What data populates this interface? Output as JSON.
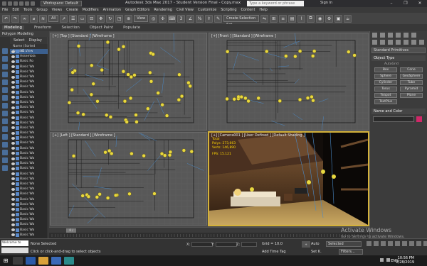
{
  "titlebar": {
    "workspace": "Workspace: Default",
    "title": "Autodesk 3ds Max 2017 - Student Version    Final - Copy.max",
    "search_placeholder": "Type a keyword or phrase",
    "signin": "Sign In"
  },
  "menu": [
    "File",
    "Edit",
    "Tools",
    "Group",
    "Views",
    "Create",
    "Modifiers",
    "Animation",
    "Graph Editors",
    "Rendering",
    "Civil View",
    "Customize",
    "Scripting",
    "Content",
    "Help"
  ],
  "toolbar": {
    "undo": "↶",
    "redo": "↷",
    "filter": "All",
    "view": "View",
    "selection_set": "Create Selection Set"
  },
  "ribbon": {
    "tabs": [
      "Modeling",
      "Freeform",
      "Selection",
      "Object Paint",
      "Populate"
    ],
    "polymod": "Polygon Modeling"
  },
  "explorer": {
    "tabs": [
      "Select",
      "Display"
    ],
    "column_header": "Name (Sorted Ascend...",
    "rows": [
      "3D View",
      "Assembla",
      "Basic Ro",
      "Basic Wa",
      "Basic Wa",
      "Basic Wa",
      "Basic Wa",
      "Basic Wa",
      "Basic Wa",
      "Basic Wa",
      "Basic Wa",
      "Basic Wa",
      "Basic Wa",
      "Basic Wa",
      "Basic Wa",
      "Basic Wa",
      "Basic Wa",
      "Basic Wa",
      "Basic Wa",
      "Basic Wa",
      "Basic Wa",
      "Basic Wa",
      "Basic Wa",
      "Basic Wa",
      "Basic Wa",
      "Basic Wa",
      "Basic Wa",
      "Basic Wa",
      "Basic Wa",
      "Basic Wa",
      "Basic Wa",
      "Basic Wa",
      "Basic Wa",
      "Basic Wa",
      "Basic Wa",
      "Basic Wa",
      "Basic Wa"
    ]
  },
  "viewports": {
    "top": "[+] [Top ] [Standard ] [Wireframe ]",
    "front": "[+] [Front ] [Standard ] [Wireframe ]",
    "left": "[+] [Left ] [Standard ] [Wireframe ]",
    "camera": "[+] [Camera001 ] [User Defined ] [Default Shading ]",
    "stats": {
      "total_label": "Total",
      "polys_label": "Polys:",
      "polys_value": "273,663",
      "verts_label": "Verts:",
      "verts_value": "146,890",
      "fps_label": "FPS:",
      "fps_value": "15.121"
    }
  },
  "command_panel": {
    "dropdown": "Standard Primitives",
    "section_object_type": "Object Type",
    "autogrid": "AutoGrid",
    "primitives": [
      "Box",
      "Cone",
      "Sphere",
      "GeoSphere",
      "Cylinder",
      "Tube",
      "Torus",
      "Pyramid",
      "Teapot",
      "Plane",
      "TextPlus"
    ],
    "section_name_color": "Name and Color"
  },
  "time": {
    "slider": "0 / 100"
  },
  "status": {
    "maxscript": "Welcome to MAX",
    "none_selected": "None Selected",
    "hint": "Click or click-and-drag to select objects",
    "x_label": "X:",
    "y_label": "Y:",
    "z_label": "Z:",
    "grid": "Grid = 10.0",
    "add_time_tag": "Add Time Tag",
    "auto": "Auto",
    "set_k": "Set K.",
    "selected": "Selected",
    "filters": "Filters..."
  },
  "watermark": {
    "line1": "Activate Windows",
    "line2": "Go to Settings to activate Windows."
  },
  "taskbar": {
    "lang": "ENG",
    "time": "10:56 PM",
    "date": "2/28/2019"
  },
  "colors": {
    "accent": "#d4b23a",
    "name_swatch": "#d02868",
    "light_marker": "#e8d840"
  }
}
